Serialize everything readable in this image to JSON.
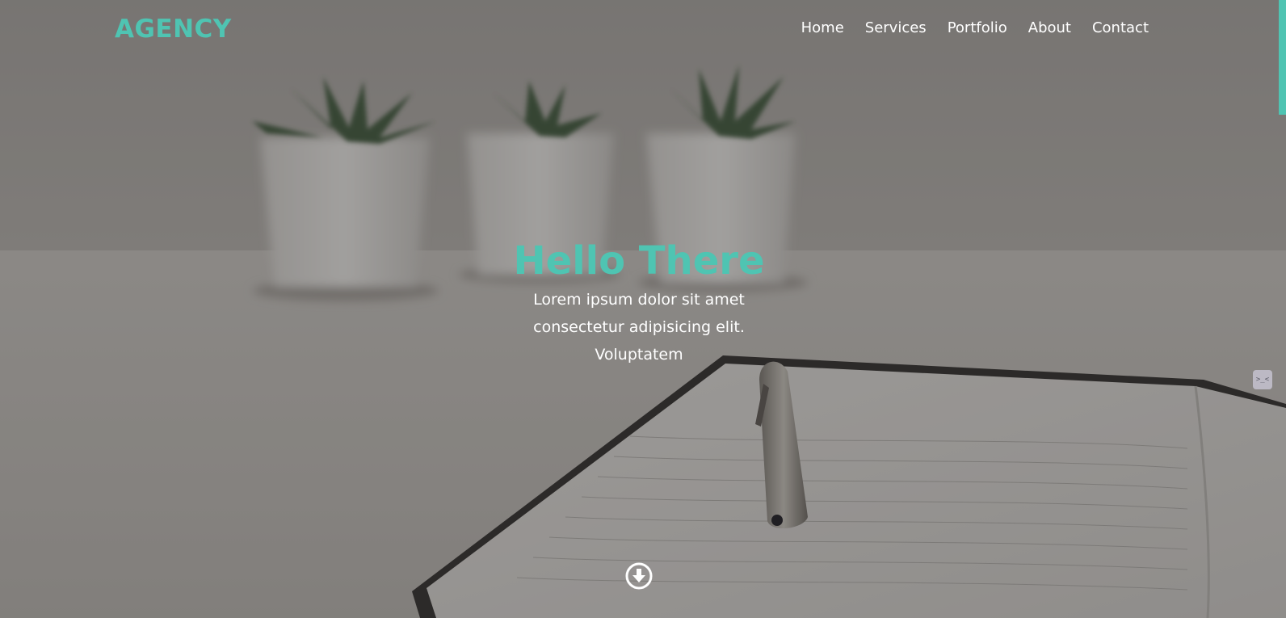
{
  "nav": {
    "brand": "AGENCY",
    "links": [
      "Home",
      "Services",
      "Portfolio",
      "About",
      "Contact"
    ]
  },
  "hero": {
    "title": "Hello There",
    "subtitle": "Lorem ipsum dolor sit amet consectetur adipisicing elit. Voluptatem"
  },
  "scroll_down": {
    "icon": "arrow-circle-down-icon"
  },
  "side_widget": {
    "icon": "extension-face-icon"
  },
  "colors": {
    "accent": "#4fc4b2",
    "text_light": "#ffffff",
    "overlay": "rgba(40,38,36,0.38)"
  }
}
